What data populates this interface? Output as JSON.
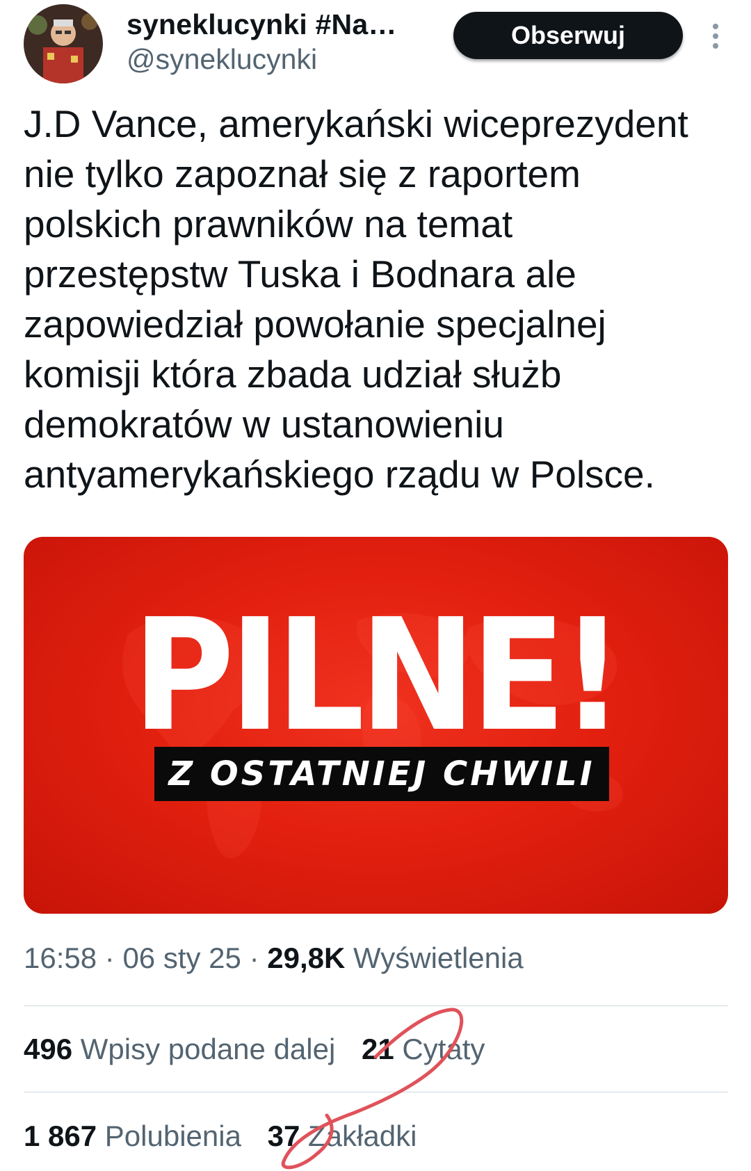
{
  "header": {
    "display_name": "syneklucynki #Na…",
    "handle": "@syneklucynki",
    "follow_label": "Obserwuj"
  },
  "tweet": {
    "text": "J.D Vance, amerykański wiceprezydent\nnie tylko zapoznał się z raportem\npolskich prawników na temat\nprzestępstw Tuska i Bodnara ale\nzapowiedział powołanie specjalnej\nkomisji która zbada udział służb\ndemokratów w ustanowieniu\nantyamerykańskiego rządu w Polsce."
  },
  "media": {
    "headline": "PILNE!",
    "subline": "Z OSTATNIEJ CHWILI"
  },
  "meta": {
    "time": "16:58",
    "separator": "·",
    "date": "06 sty 25",
    "views_count": "29,8K",
    "views_label": "Wyświetlenia"
  },
  "stats": {
    "retweets_count": "496",
    "retweets_label": "Wpisy podane dalej",
    "quotes_count": "21",
    "quotes_label": "Cytaty",
    "likes_count": "1 867",
    "likes_label": "Polubienia",
    "bookmarks_count": "37",
    "bookmarks_label": "Zakładki"
  },
  "colors": {
    "text_primary": "#0f1419",
    "text_secondary": "#536471",
    "button_bg": "#0f1419",
    "media_red": "#e3200f",
    "annotation_red": "#e0525a"
  },
  "icons": [
    "avatar",
    "more-vertical-icon",
    "hand-drawn-circle-annotation"
  ]
}
